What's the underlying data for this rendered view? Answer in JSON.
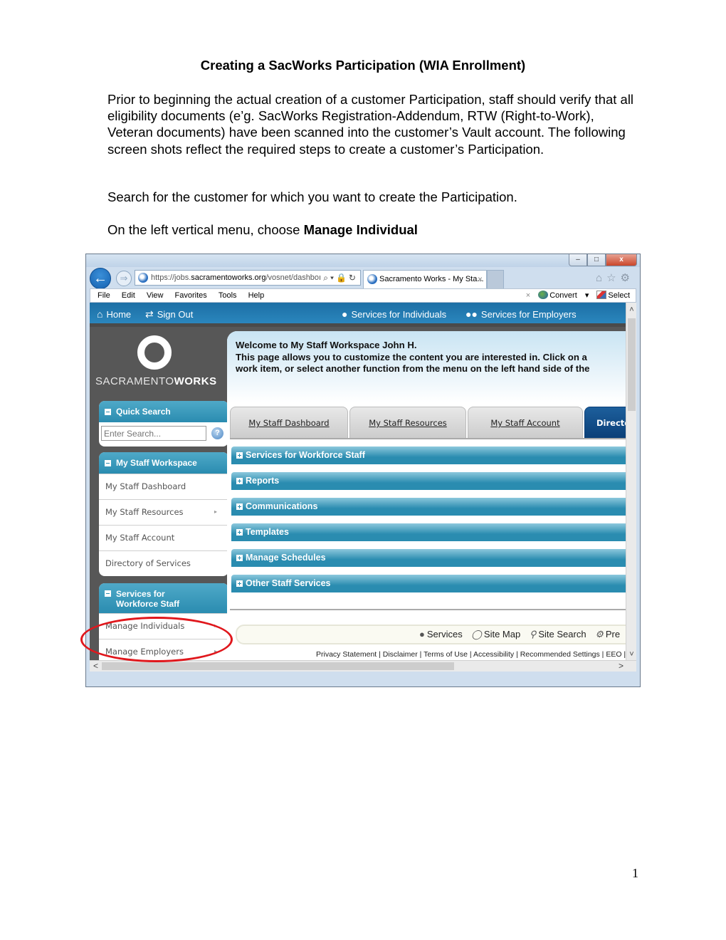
{
  "document": {
    "title": "Creating a SacWorks Participation (WIA Enrollment)",
    "intro": "Prior to beginning the actual creation of a customer Participation, staff should verify that all eligibility documents (e’g. SacWorks Registration-Addendum, RTW (Right-to-Work), Veteran documents)  have been scanned into the customer’s Vault account. The following screen shots reflect the required steps to create a customer’s Participation.",
    "step1": "Search for the customer for which you want to create the Participation.",
    "step2_prefix": "On the left vertical menu, choose ",
    "step2_bold": "Manage Individual",
    "page_number": "1"
  },
  "browser": {
    "window_buttons": {
      "minimize": "–",
      "maximize": "□",
      "close": "x"
    },
    "address": {
      "scheme": "https://",
      "host_prefix": "jobs.",
      "host": "sacramentoworks.org",
      "path": "/vosnet/dashboı"
    },
    "address_tools": "⌕▾🔒↻",
    "tab_title": "Sacramento Works - My Sta...",
    "tab_close": "×",
    "toolbar_icons": "⌂☆⚙",
    "menu": [
      "File",
      "Edit",
      "View",
      "Favorites",
      "Tools",
      "Help"
    ],
    "commands": {
      "close": "×",
      "convert": "Convert",
      "convert_arrow": "▾",
      "select": "Select"
    }
  },
  "site": {
    "nav": {
      "home": "Home",
      "sign_out": "Sign Out",
      "individuals": "Services for Individuals",
      "employers": "Services for Employers"
    },
    "logo": {
      "light": "SACRAMENTO",
      "bold": "WORKS"
    },
    "sidebar": {
      "quick_search": {
        "title": "Quick Search",
        "placeholder": "Enter Search...",
        "help": "?"
      },
      "workspace": {
        "title": "My Staff Workspace",
        "items": [
          {
            "label": "My Staff Dashboard",
            "has_submenu": false
          },
          {
            "label": "My Staff Resources",
            "has_submenu": true
          },
          {
            "label": "My Staff Account",
            "has_submenu": false
          },
          {
            "label": "Directory of Services",
            "has_submenu": false
          }
        ]
      },
      "workforce": {
        "title_line1": "Services for",
        "title_line2": "Workforce Staff",
        "items": [
          {
            "label": "Manage Individuals",
            "has_submenu": true,
            "highlighted": true
          },
          {
            "label": "Manage Employers",
            "has_submenu": true
          }
        ]
      },
      "submenu_arrow": "▸"
    },
    "welcome": {
      "line1": "Welcome to My Staff Workspace John H.",
      "line2": "This page allows you to customize the content you are interested in. Click on a",
      "line3": "work item, or select another function from the menu on the left hand side of the"
    },
    "tabs": [
      {
        "label": "My Staff Dashboard",
        "active": false
      },
      {
        "label": "My Staff Resources",
        "active": false
      },
      {
        "label": "My Staff Account",
        "active": false
      },
      {
        "label": "Directo",
        "active": true
      }
    ],
    "sections": [
      "Services for Workforce Staff",
      "Reports",
      "Communications",
      "Templates",
      "Manage Schedules",
      "Other Staff Services"
    ],
    "footer_links": [
      "Services",
      "Site Map",
      "Site Search",
      "Pre"
    ],
    "legal": "Privacy Statement | Disclaimer | Terms of Use | Accessibility | Recommended Settings | EEO | F",
    "scroll": {
      "up": "˄",
      "down": "˅",
      "left": "<",
      "right": ">"
    }
  },
  "colors": {
    "nav_blue": "#1d6fa5",
    "section_teal": "#2a8cb0",
    "active_tab": "#0a3f78",
    "annotation_red": "#e0171c"
  }
}
